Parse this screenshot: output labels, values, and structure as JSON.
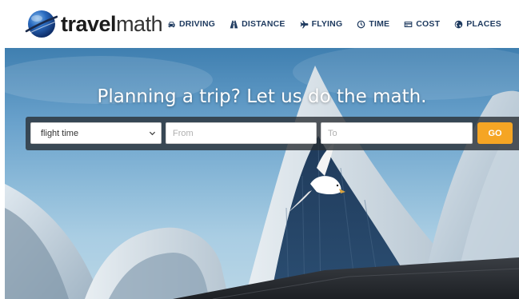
{
  "brand": {
    "bold": "travel",
    "light": "math"
  },
  "nav": {
    "items": [
      {
        "label": "DRIVING",
        "icon": "car-icon"
      },
      {
        "label": "DISTANCE",
        "icon": "road-icon"
      },
      {
        "label": "FLYING",
        "icon": "plane-icon"
      },
      {
        "label": "TIME",
        "icon": "clock-icon"
      },
      {
        "label": "COST",
        "icon": "credit-card-icon"
      },
      {
        "label": "PLACES",
        "icon": "globe-icon"
      }
    ]
  },
  "hero": {
    "headline": "Planning a trip? Let us do the math."
  },
  "search": {
    "mode_selected": "flight time",
    "from_placeholder": "From",
    "to_placeholder": "To",
    "go_label": "GO"
  },
  "colors": {
    "nav_text": "#1e3a5f",
    "go_button": "#f5a524",
    "search_bar_bg": "#2d3237"
  }
}
